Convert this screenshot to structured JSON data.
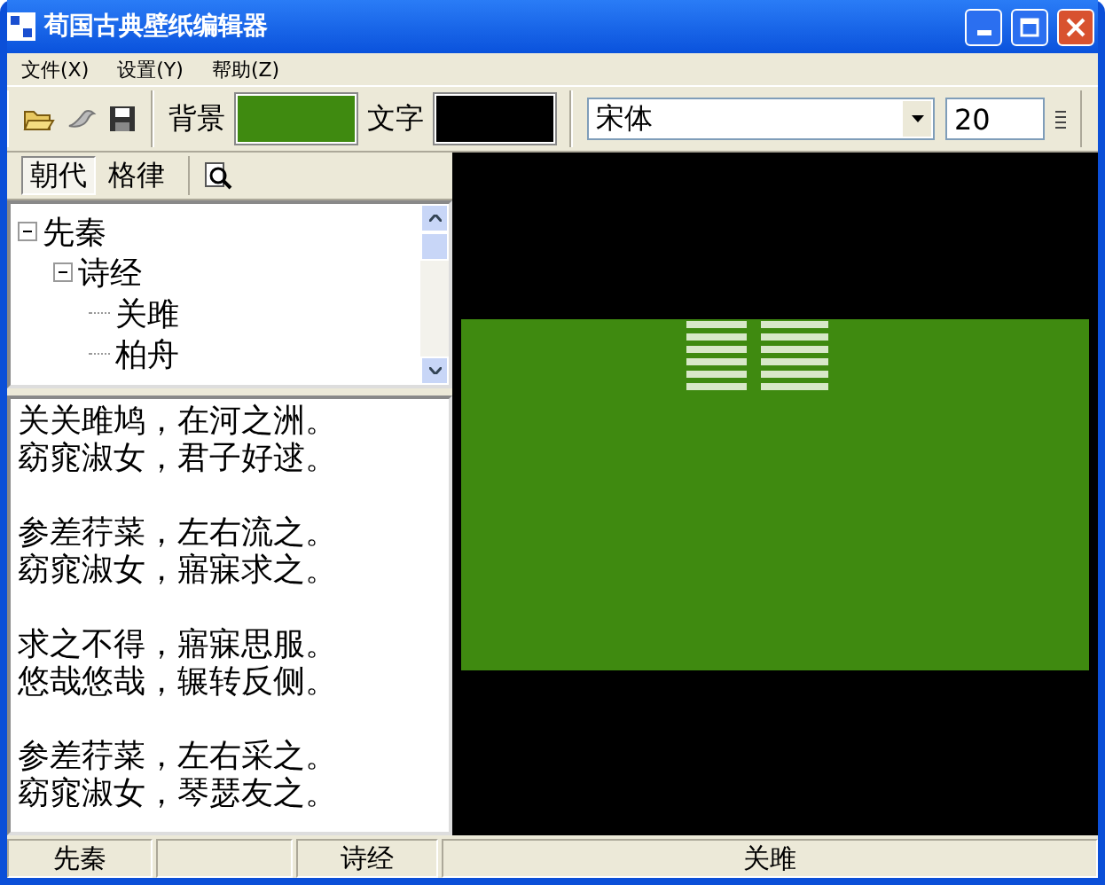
{
  "window": {
    "title": "荀国古典壁纸编辑器"
  },
  "menu": [
    {
      "label": "文件(X)"
    },
    {
      "label": "设置(Y)"
    },
    {
      "label": "帮助(Z)"
    }
  ],
  "toolbar": {
    "swatches": [
      {
        "label": "背景",
        "color": "#3f8a10"
      },
      {
        "label": "文字",
        "color": "#000000"
      }
    ],
    "font": "宋体",
    "font_size": "20"
  },
  "tabs": [
    {
      "label": "朝代",
      "selected": true
    },
    {
      "label": "格律",
      "selected": false
    }
  ],
  "tree": [
    {
      "label": "先秦",
      "expanded": true,
      "children": [
        {
          "label": "诗经",
          "expanded": true,
          "children": [
            {
              "label": "关雎"
            },
            {
              "label": "柏舟"
            }
          ]
        }
      ]
    }
  ],
  "poem": [
    [
      "关关雎鸠，在河之洲。",
      "窈窕淑女，君子好逑。"
    ],
    [
      "参差荇菜，左右流之。",
      "窈窕淑女，寤寐求之。"
    ],
    [
      "求之不得，寤寐思服。",
      "悠哉悠哉，辗转反侧。"
    ],
    [
      "参差荇菜，左右采之。",
      "窈窕淑女，琴瑟友之。"
    ]
  ],
  "status_bar": [
    {
      "kind": "text",
      "text": "先秦"
    },
    {
      "kind": "blank"
    },
    {
      "kind": "text",
      "text": "诗经"
    },
    {
      "kind": "text",
      "text": "关雎"
    }
  ]
}
